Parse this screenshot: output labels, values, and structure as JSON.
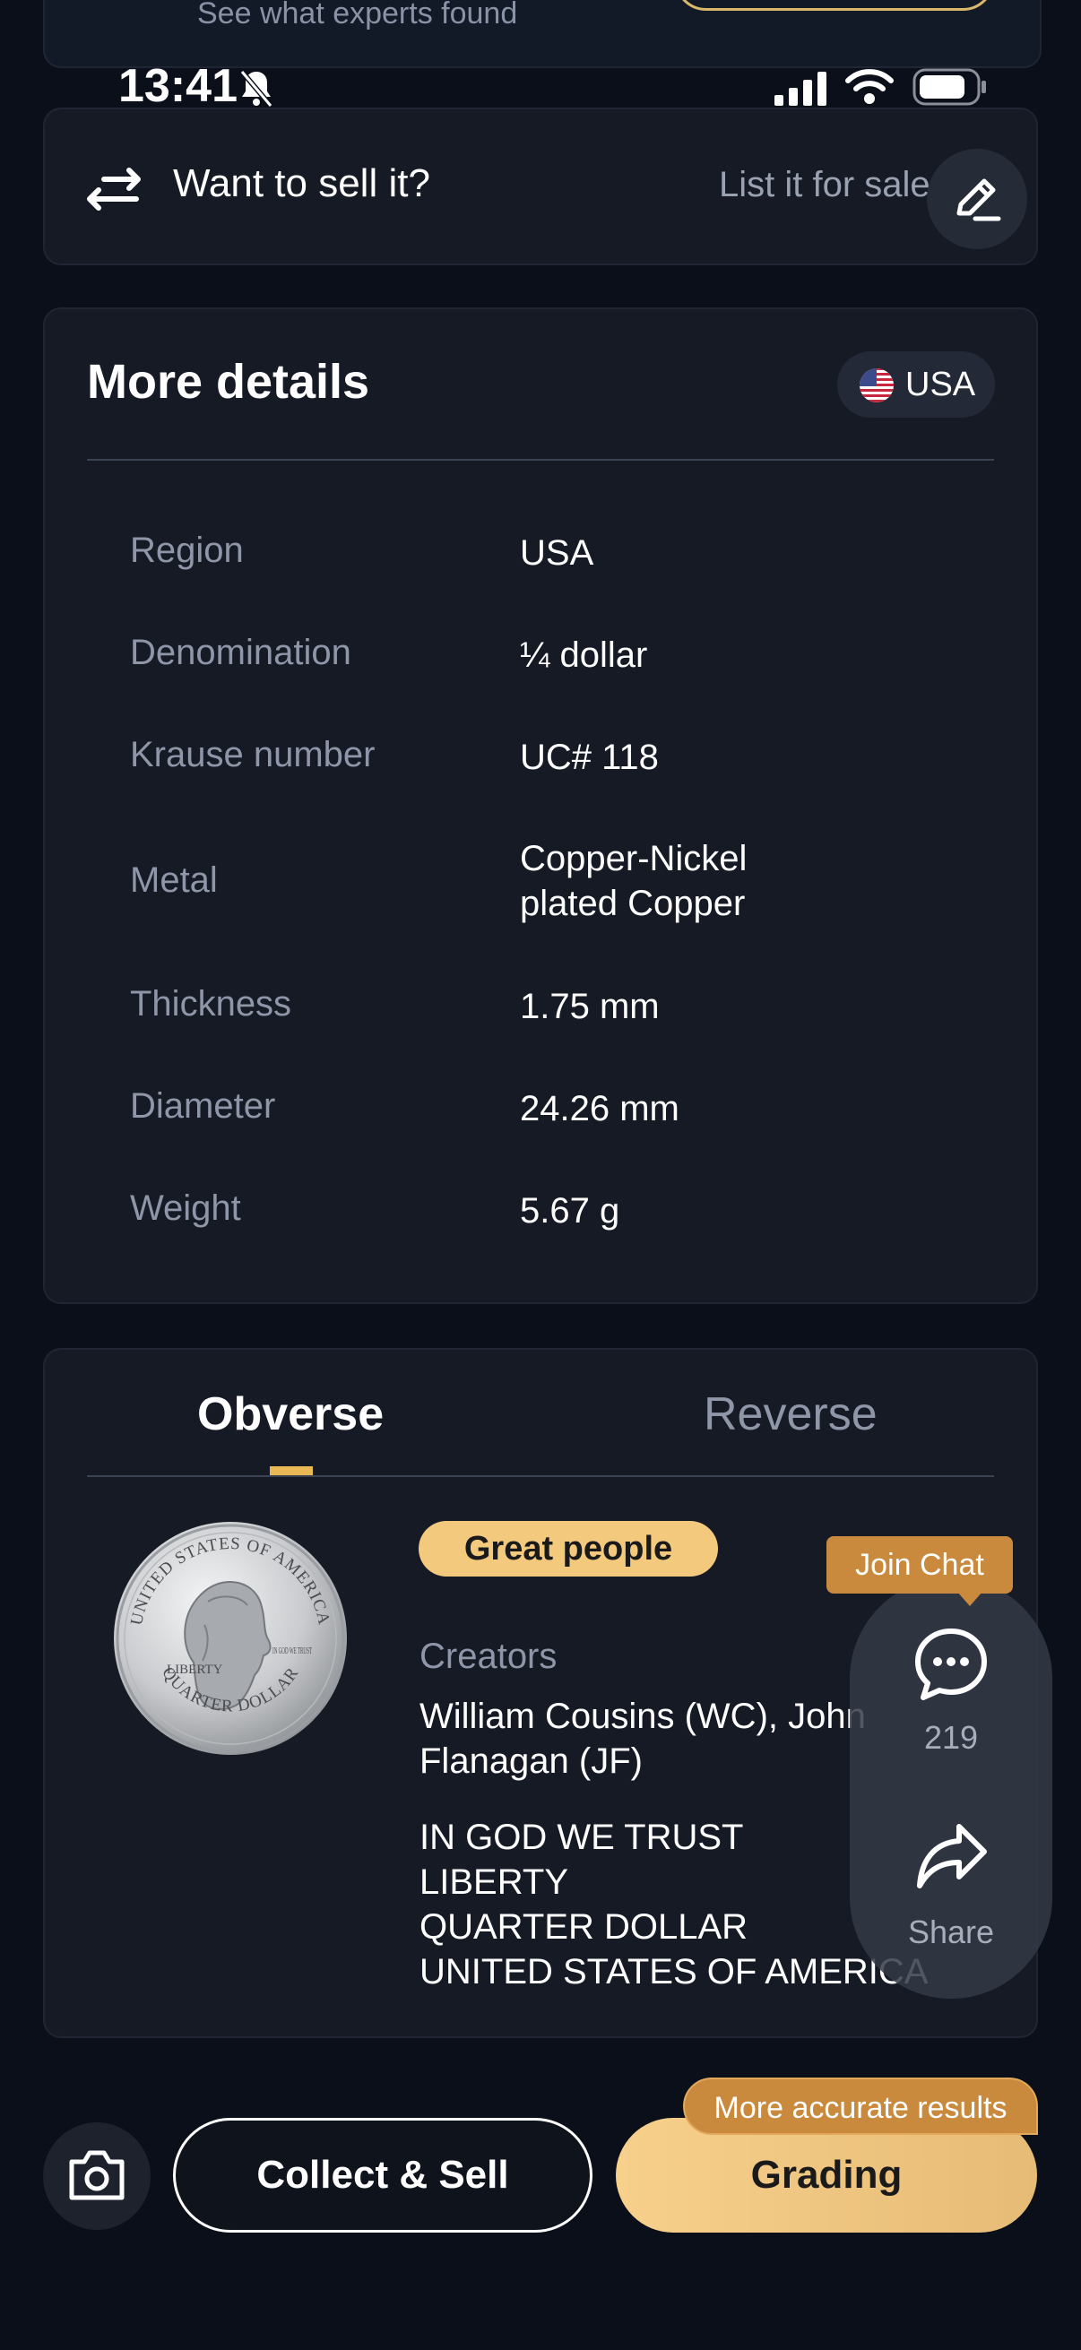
{
  "top_card": {
    "subtitle": "See what experts found"
  },
  "status_bar": {
    "time": "13:41"
  },
  "sell": {
    "label": "Want to sell it?",
    "link": "List it for sale"
  },
  "details": {
    "title": "More details",
    "country": "USA",
    "rows": [
      {
        "label": "Region",
        "value": "USA"
      },
      {
        "label": "Denomination",
        "value": "¼ dollar"
      },
      {
        "label": "Krause number",
        "value": "UC# 118"
      },
      {
        "label": "Metal",
        "value": "Copper-Nickel plated Copper"
      },
      {
        "label": "Thickness",
        "value": "1.75 mm"
      },
      {
        "label": "Diameter",
        "value": "24.26 mm"
      },
      {
        "label": "Weight",
        "value": "5.67 g"
      }
    ]
  },
  "sides": {
    "tabs": [
      "Obverse",
      "Reverse"
    ],
    "active_tab": "Obverse",
    "theme": "Great people",
    "creators_label": "Creators",
    "creators": "William Cousins (WC), John Flanagan (JF)",
    "inscriptions": [
      "IN GOD WE TRUST",
      "LIBERTY",
      "QUARTER DOLLAR",
      "UNITED STATES OF AMERICA"
    ],
    "coin_text": {
      "top": "UNITED STATES OF AMERICA",
      "bottom": "QUARTER DOLLAR",
      "left": "LIBERTY",
      "motto": "IN GOD WE TRUST"
    }
  },
  "floating": {
    "join_chat": "Join Chat",
    "comment_count": "219",
    "share": "Share"
  },
  "bottom": {
    "collect": "Collect & Sell",
    "grading": "Grading",
    "grading_tag": "More accurate results"
  },
  "colors": {
    "accent_gold": "#e9b955",
    "tag_orange": "#c98a3e",
    "background": "#0b0f1a"
  }
}
